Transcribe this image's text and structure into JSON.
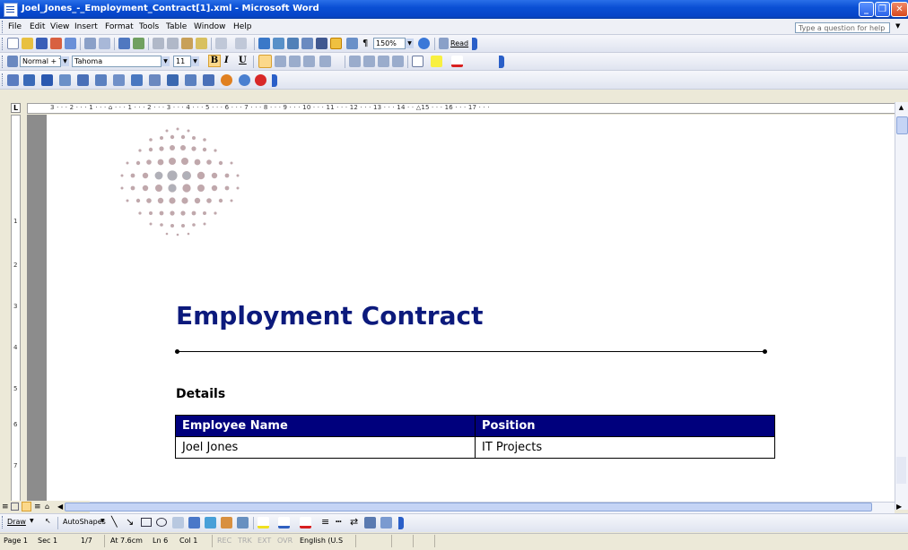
{
  "window": {
    "title": "Joel_Jones_-_Employment_Contract[1].xml - Microsoft Word",
    "minimize_glyph": "_",
    "restore_glyph": "❐",
    "close_glyph": "✕"
  },
  "menubar": {
    "items": [
      "File",
      "Edit",
      "View",
      "Insert",
      "Format",
      "Tools",
      "Table",
      "Window",
      "Help"
    ],
    "help_placeholder": "Type a question for help"
  },
  "standard_toolbar": {
    "zoom": "150%",
    "read_label": "Read"
  },
  "formatting_toolbar": {
    "style": "Normal + Tahoma",
    "font": "Tahoma",
    "size": "11",
    "bold": "B",
    "italic": "I",
    "underline": "U"
  },
  "ruler": {
    "horizontal_text": "3 · · · 2 · · · 1 · · · ⌂ · · · 1 · · · 2 · · · 3 · · · 4 · · · 5 · · · 6 · · · 7 · · · 8 · · · 9 · · · 10 · · · 11 · · · 12 · · · 13 · · · 14 · · △15 · · · 16 · · · 17 · · ·",
    "vertical_numbers": [
      "1",
      "2",
      "3",
      "4",
      "5",
      "6",
      "7"
    ]
  },
  "document": {
    "title": "Employment Contract",
    "section_heading": "Details",
    "table": {
      "headers": [
        "Employee Name",
        "Position"
      ],
      "rows": [
        [
          "Joel Jones",
          "IT Projects"
        ]
      ]
    }
  },
  "drawing_toolbar": {
    "draw_label": "Draw",
    "autoshapes_label": "AutoShapes"
  },
  "statusbar": {
    "page": "Page 1",
    "section": "Sec 1",
    "page_of": "1/7",
    "at": "At 7.6cm",
    "line": "Ln 6",
    "col": "Col 1",
    "rec": "REC",
    "trk": "TRK",
    "ext": "EXT",
    "ovr": "OVR",
    "language": "English (U.S"
  },
  "colors": {
    "title_blue": "#0c1a7c",
    "table_header_bg": "#00007d",
    "titlebar_blue": "#0a4fd4"
  }
}
